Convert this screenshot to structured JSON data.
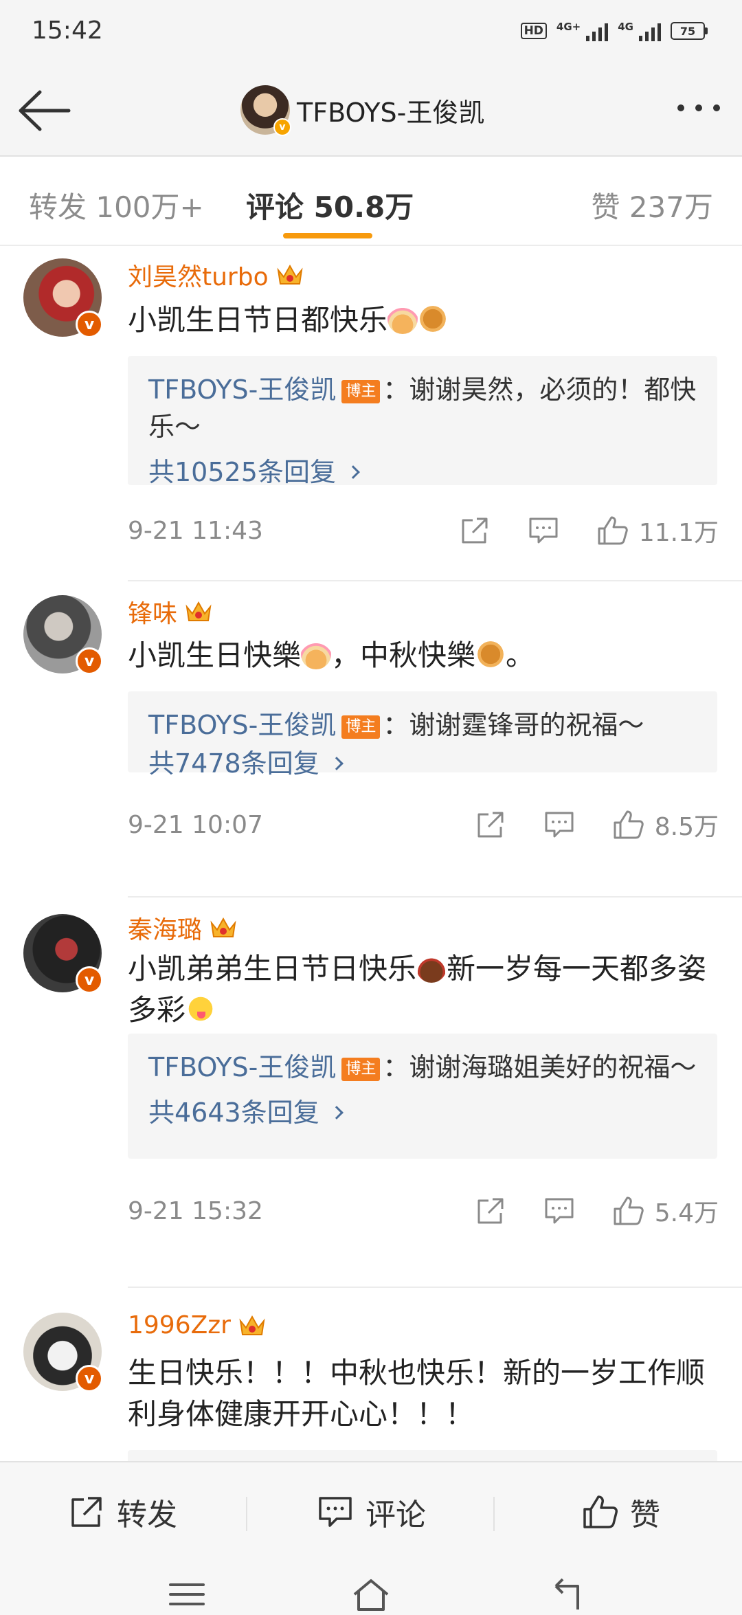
{
  "status_bar": {
    "time": "15:42",
    "hd": "HD",
    "network1": "4G+",
    "network2": "4G",
    "battery": "75"
  },
  "header": {
    "title": "TFBOYS-王俊凯",
    "back_icon": "back-arrow-icon",
    "more_icon": "more-dots-icon"
  },
  "tabs": {
    "repost": "转发 100万+",
    "comment": "评论 50.8万",
    "like": "赞 237万"
  },
  "comments": [
    {
      "name": "刘昊然turbo",
      "text": "小凯生日节日都快乐",
      "reply": {
        "author": "TFBOYS-王俊凯",
        "badge": "博主",
        "text": "：谢谢昊然，必须的！都快乐～",
        "count": "共10525条回复"
      },
      "time": "9-21 11:43",
      "likes": "11.1万"
    },
    {
      "name": "锋味",
      "text_part1": "小凯生日快樂",
      "text_part2": "，中秋快樂",
      "text_part3": "。",
      "reply": {
        "author": "TFBOYS-王俊凯",
        "badge": "博主",
        "text": "：谢谢霆锋哥的祝福～",
        "count": "共7478条回复"
      },
      "time": "9-21 10:07",
      "likes": "8.5万"
    },
    {
      "name": "秦海璐",
      "text_part1": "小凯弟弟生日节日快乐",
      "text_part2": "新一岁每一天都多姿多彩",
      "reply": {
        "author": "TFBOYS-王俊凯",
        "badge": "博主",
        "text": "：谢谢海璐姐美好的祝福～",
        "count": "共4643条回复"
      },
      "time": "9-21 15:32",
      "likes": "5.4万"
    },
    {
      "name": "1996Zzr",
      "text": "生日快乐！！！中秋也快乐！新的一岁工作顺利身体健康开开心心！！！"
    }
  ],
  "bottom_bar": {
    "repost": "转发",
    "comment": "评论",
    "like": "赞"
  },
  "colors": {
    "accent": "#f79a0d",
    "name": "#e86b0a",
    "link": "#4a6d99",
    "badge": "#f47d1f"
  }
}
